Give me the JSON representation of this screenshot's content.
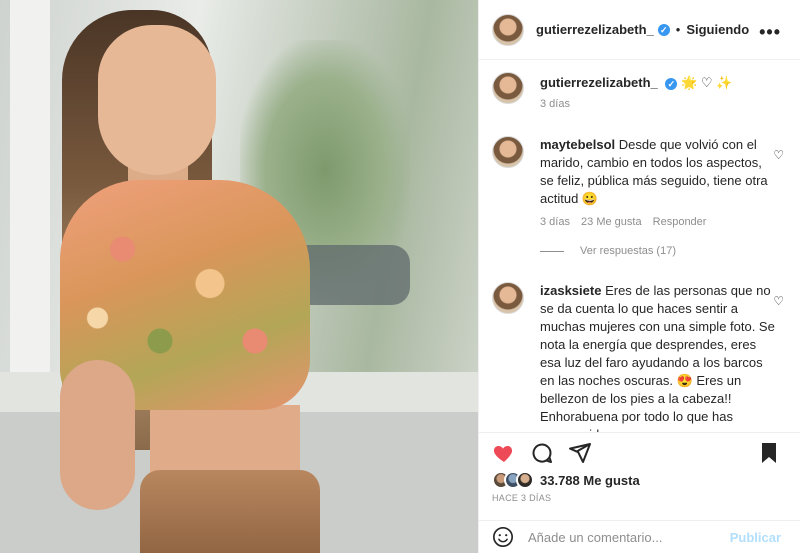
{
  "header": {
    "username": "gutierrezelizabeth_",
    "separator": "•",
    "follow_label": "Siguiendo",
    "more_label": "•••"
  },
  "caption": {
    "username": "gutierrezelizabeth_",
    "emojis": "🌟 ♡ ✨",
    "time": "3 días"
  },
  "comments": [
    {
      "username": "maytebelsol",
      "text": "Desde que volvió con el marido, cambio en todos los aspectos, se feliz, pública más seguido, tiene otra actitud 😀",
      "time": "3 días",
      "likes": "23 Me gusta",
      "reply": "Responder",
      "view_replies": "Ver respuestas (17)"
    },
    {
      "username": "izasksiete",
      "text": "Eres de las personas que no se da cuenta lo que haces sentir a muchas mujeres con una simple foto. Se nota la energía que desprendes, eres esa luz del faro ayudando a los barcos en las noches oscuras. 😍 Eres un bellezon de los pies a la cabeza!! Enhorabuena por todo lo que has conseguido"
    }
  ],
  "actions": {
    "likes": "33.788 Me gusta",
    "date": "HACE 3 DÍAS"
  },
  "add_comment": {
    "placeholder": "Añade un comentario...",
    "publish": "Publicar"
  },
  "colors": {
    "like_red": "#ed4956",
    "verified_blue": "#3897f0",
    "publish_disabled": "#b2dffc"
  }
}
